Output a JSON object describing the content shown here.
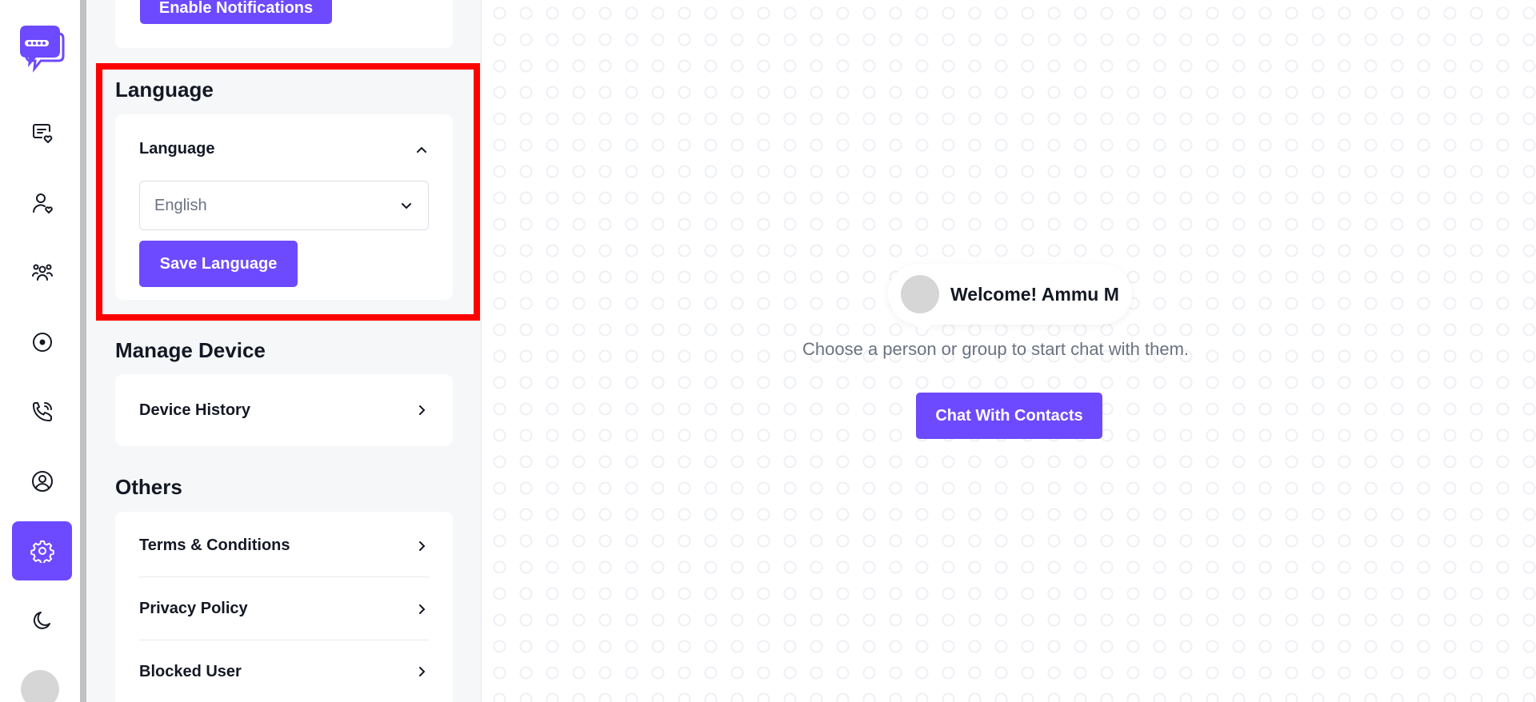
{
  "rail": {
    "items": [
      {
        "icon": "chat-heart-icon"
      },
      {
        "icon": "contacts-icon"
      },
      {
        "icon": "groups-icon"
      },
      {
        "icon": "status-icon"
      },
      {
        "icon": "calls-icon"
      },
      {
        "icon": "profile-icon"
      },
      {
        "icon": "settings-icon",
        "active": true
      },
      {
        "icon": "moon-icon"
      }
    ],
    "accent": "#6d4aff"
  },
  "notifications": {
    "enable_label": "Enable Notifications"
  },
  "language": {
    "section_title": "Language",
    "card_title": "Language",
    "selected": "English",
    "save_label": "Save Language"
  },
  "manage_device": {
    "section_title": "Manage Device",
    "device_history_label": "Device History"
  },
  "others": {
    "section_title": "Others",
    "items": [
      {
        "label": "Terms & Conditions"
      },
      {
        "label": "Privacy Policy"
      },
      {
        "label": "Blocked User"
      }
    ]
  },
  "main": {
    "welcome": "Welcome! Ammu M",
    "subtitle": "Choose a person or group to start chat with them.",
    "cta_label": "Chat With Contacts"
  }
}
